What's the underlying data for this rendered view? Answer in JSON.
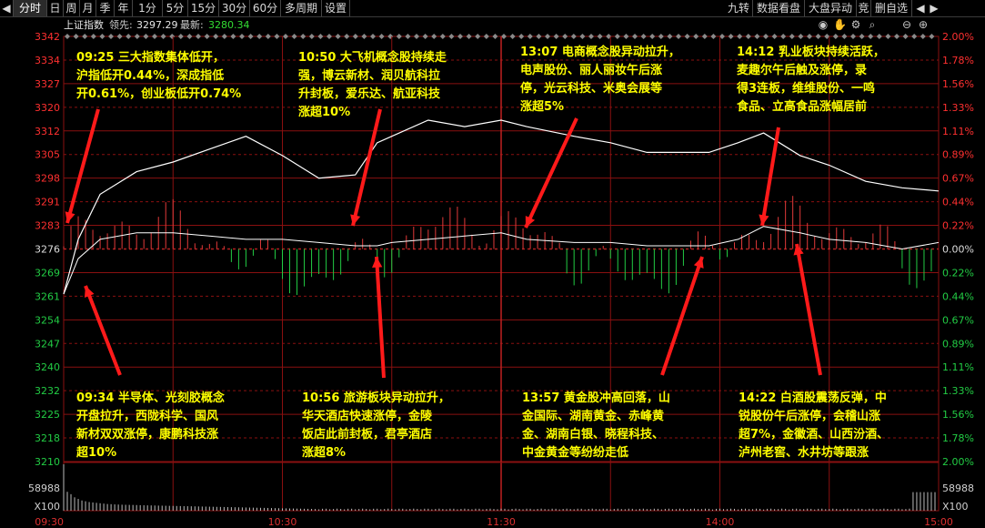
{
  "toolbar": {
    "back": "◀",
    "items": [
      "分时",
      "日",
      "周",
      "月",
      "季",
      "年",
      "1分",
      "5分",
      "15分",
      "30分",
      "60分",
      "多周期",
      "设置"
    ],
    "right_items": [
      "九转",
      "数据看盘",
      "大盘异动",
      "竞",
      "删自选"
    ],
    "arrows": [
      "◀",
      "▶"
    ]
  },
  "infobar": {
    "index_name": "上证指数",
    "prev_label": "领先:",
    "prev_value": "3297.29",
    "latest_label": "最新:",
    "latest_value": "3280.34",
    "icons": [
      "eye-icon",
      "hand-icon",
      "gear-icon",
      "search-icon",
      "minus-icon",
      "plus-icon"
    ]
  },
  "colors": {
    "up": "#e23a3a",
    "down": "#22cc44",
    "axis_text_up": "#ff3030",
    "axis_text_down": "#22cc44",
    "grid": "#8a1010",
    "note": "#ffff00",
    "arrow": "#ff1a1a",
    "price_line": "#ffffff",
    "avg_line": "#ffffff"
  },
  "chart_data": {
    "type": "line",
    "index": "上证指数",
    "base_price": 3276,
    "y_ticks": [
      "3342",
      "3334",
      "3327",
      "3320",
      "3312",
      "3305",
      "3298",
      "3291",
      "3283",
      "3276",
      "3269",
      "3261",
      "3254",
      "3247",
      "3240",
      "3232",
      "3225",
      "3218",
      "3210"
    ],
    "pct_ticks": [
      "2.00%",
      "1.78%",
      "1.56%",
      "1.33%",
      "1.11%",
      "0.89%",
      "0.67%",
      "0.44%",
      "0.22%",
      "0.00%",
      "0.22%",
      "0.44%",
      "0.67%",
      "0.89%",
      "1.11%",
      "1.33%",
      "1.56%",
      "1.78%",
      "2.00%"
    ],
    "x_ticks": [
      "09:30",
      "10:30",
      "11:30",
      "14:00",
      "15:00"
    ],
    "ylim": [
      3210,
      3342
    ],
    "price_series_x": [
      "09:30",
      "09:34",
      "09:40",
      "09:50",
      "10:00",
      "10:10",
      "10:20",
      "10:30",
      "10:40",
      "10:50",
      "10:56",
      "11:00",
      "11:10",
      "11:20",
      "11:30",
      "13:07",
      "13:20",
      "13:30",
      "13:40",
      "13:57",
      "14:05",
      "14:12",
      "14:22",
      "14:30",
      "14:40",
      "14:50",
      "15:00"
    ],
    "price_series": [
      3262,
      3279,
      3293,
      3300,
      3303,
      3307,
      3311,
      3305,
      3298,
      3299,
      3309,
      3311,
      3316,
      3314,
      3316,
      3314,
      3311,
      3309,
      3306,
      3306,
      3309,
      3312,
      3305,
      3302,
      3297,
      3295,
      3294
    ],
    "avg_series": [
      3262,
      3273,
      3279,
      3281,
      3281,
      3280,
      3279,
      3279,
      3278,
      3277,
      3277,
      3278,
      3279,
      3280,
      3281,
      3279,
      3278,
      3278,
      3277,
      3277,
      3279,
      3283,
      3281,
      3279,
      3278,
      3276,
      3278
    ],
    "volume_label": "58988",
    "volume_unit": "X100",
    "volume_max": 58988,
    "volume_bars": [
      58988,
      24000,
      21000,
      17000,
      15000,
      13000,
      12000,
      11000,
      10500,
      10000,
      9500,
      9000,
      8500,
      8300,
      8000,
      7800,
      7600,
      7500,
      7400,
      7300,
      7200,
      7000,
      6900,
      6800,
      6700,
      6600,
      6500,
      6400,
      6300,
      6200,
      6100,
      6000,
      5900,
      5800,
      5700,
      5600,
      5500,
      5400,
      5300,
      5200,
      5100,
      5000,
      4900,
      4800,
      4700,
      4600,
      4500,
      4400,
      4300,
      4200,
      4100,
      4000,
      3900,
      3800,
      3700,
      3600,
      3500,
      3400,
      3300,
      3200,
      3100,
      3000,
      2900,
      2800,
      2700,
      2600,
      2500,
      2400,
      2300,
      2200
    ]
  },
  "annotations": [
    {
      "id": "n1",
      "time": "09:25",
      "text": "09:25 三大指数集体低开，\n沪指低开0.44%，深成指低\n开0.61%，创业板低开0.74%"
    },
    {
      "id": "n2",
      "time": "10:50",
      "text": "10:50 大飞机概念股持续走\n强，博云新材、润贝航科拉\n升封板，爱乐达、航亚科技\n涨超10%"
    },
    {
      "id": "n3",
      "time": "13:07",
      "text": "13:07 电商概念股异动拉升，\n电声股份、丽人丽妆午后涨\n停，光云科技、米奥会展等\n涨超5%"
    },
    {
      "id": "n4",
      "time": "14:12",
      "text": "14:12 乳业板块持续活跃，\n麦趣尔午后触及涨停，录\n得3连板，维维股份、一鸣\n食品、立高食品涨幅居前"
    },
    {
      "id": "n5",
      "time": "09:34",
      "text": "09:34 半导体、光刻胶概念\n开盘拉升，西陇科学、国风\n新材双双涨停，康鹏科技涨\n超10%"
    },
    {
      "id": "n6",
      "time": "10:56",
      "text": "10:56 旅游板块异动拉升，\n华天酒店快速涨停，金陵\n饭店此前封板，君亭酒店\n涨超8%"
    },
    {
      "id": "n7",
      "time": "13:57",
      "text": "13:57 黄金股冲高回落，山\n金国际、湖南黄金、赤峰黄\n金、湖南白银、晓程科技、\n中金黄金等纷纷走低"
    },
    {
      "id": "n8",
      "time": "14:22",
      "text": "14:22 白酒股震荡反弹，中\n锐股份午后涨停，会稽山涨\n超7%，金徽酒、山西汾酒、\n泸州老窖、水井坊等跟涨"
    }
  ]
}
